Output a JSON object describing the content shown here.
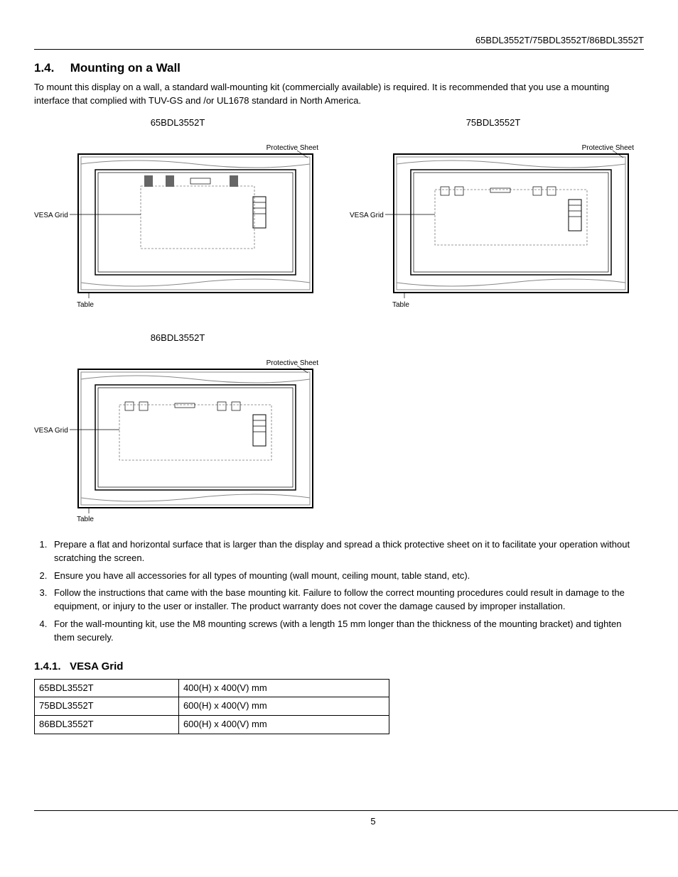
{
  "header": {
    "models": "65BDL3552T/75BDL3552T/86BDL3552T"
  },
  "section": {
    "number": "1.4.",
    "title": "Mounting on a Wall",
    "intro": "To mount this display on a wall, a standard wall-mounting kit (commercially available) is required. It is recommended that you use a mounting interface that complied with TUV-GS and /or UL1678 standard in North America."
  },
  "diagrams": [
    {
      "title": "65BDL3552T",
      "protective_sheet": "Protective Sheet",
      "vesa": "VESA Grid",
      "table": "Table"
    },
    {
      "title": "75BDL3552T",
      "protective_sheet": "Protective Sheet",
      "vesa": "VESA Grid",
      "table": "Table"
    },
    {
      "title": "86BDL3552T",
      "protective_sheet": "Protective Sheet",
      "vesa": "VESA Grid",
      "table": "Table"
    }
  ],
  "steps": [
    "Prepare a flat and horizontal surface that is larger than the display and spread a thick protective sheet on it to facilitate your operation without scratching the screen.",
    "Ensure you have all accessories for all types of mounting (wall mount, ceiling mount, table stand, etc).",
    "Follow the instructions that came with the base mounting kit. Failure to follow the correct mounting procedures could result in damage to the equipment, or injury to the user or installer. The product warranty does not cover the damage caused by improper installation.",
    "For the wall-mounting kit, use the M8 mounting screws (with a length 15 mm longer than the thickness of the mounting bracket) and tighten them securely."
  ],
  "subsection": {
    "number": "1.4.1.",
    "title": "VESA Grid"
  },
  "vesa_table": [
    {
      "model": "65BDL3552T",
      "grid": "400(H) x 400(V) mm"
    },
    {
      "model": "75BDL3552T",
      "grid": "600(H) x 400(V) mm"
    },
    {
      "model": "86BDL3552T",
      "grid": "600(H) x 400(V) mm"
    }
  ],
  "footer": {
    "page": "5"
  }
}
